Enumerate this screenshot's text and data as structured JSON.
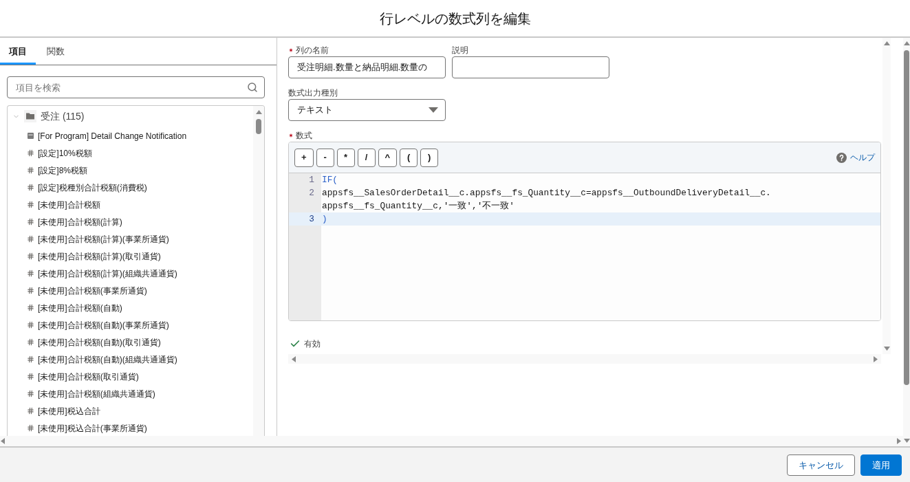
{
  "dialog": {
    "title": "行レベルの数式列を編集"
  },
  "sidebar": {
    "tabs": [
      {
        "label": "項目",
        "selected": true
      },
      {
        "label": "関数",
        "selected": false
      }
    ],
    "search": {
      "placeholder": "項目を検索"
    },
    "tree": [
      {
        "label": "受注 (115)",
        "expanded": true,
        "children": [
          {
            "kind": "date",
            "label": "[For Program] Detail Change Notification"
          },
          {
            "kind": "number",
            "label": "[設定]10%税額"
          },
          {
            "kind": "number",
            "label": "[設定]8%税額"
          },
          {
            "kind": "number",
            "label": "[設定]税種別合計税額(消費税)"
          },
          {
            "kind": "number",
            "label": "[未使用]合計税額"
          },
          {
            "kind": "number",
            "label": "[未使用]合計税額(計算)"
          },
          {
            "kind": "number",
            "label": "[未使用]合計税額(計算)(事業所通貨)"
          },
          {
            "kind": "number",
            "label": "[未使用]合計税額(計算)(取引通貨)"
          },
          {
            "kind": "number",
            "label": "[未使用]合計税額(計算)(組織共通通貨)"
          },
          {
            "kind": "number",
            "label": "[未使用]合計税額(事業所通貨)"
          },
          {
            "kind": "number",
            "label": "[未使用]合計税額(自動)"
          },
          {
            "kind": "number",
            "label": "[未使用]合計税額(自動)(事業所通貨)"
          },
          {
            "kind": "number",
            "label": "[未使用]合計税額(自動)(取引通貨)"
          },
          {
            "kind": "number",
            "label": "[未使用]合計税額(自動)(組織共通通貨)"
          },
          {
            "kind": "number",
            "label": "[未使用]合計税額(取引通貨)"
          },
          {
            "kind": "number",
            "label": "[未使用]合計税額(組織共通通貨)"
          },
          {
            "kind": "number",
            "label": "[未使用]税込合計"
          },
          {
            "kind": "number",
            "label": "[未使用]税込合計(事業所通貨)"
          }
        ]
      }
    ]
  },
  "form": {
    "column_name": {
      "label": "列の名前",
      "required": true,
      "value": "受注明細.数量と納品明細.数量の"
    },
    "description": {
      "label": "説明",
      "required": false
    },
    "output_type": {
      "label": "数式出力種別",
      "required": false,
      "value": "テキスト"
    },
    "formula": {
      "label": "数式",
      "required": true,
      "operators": [
        "+",
        "-",
        "*",
        "/",
        "^",
        "(",
        ")"
      ],
      "help": "ヘルプ",
      "lines": [
        {
          "number": "1",
          "active": false,
          "tokens": [
            {
              "kind": "keyword",
              "text": "IF("
            }
          ]
        },
        {
          "number": "2",
          "active": false,
          "tokens": [
            {
              "kind": "plain",
              "text": "appsfs__SalesOrderDetail__c.appsfs__fs_Quantity__c=appsfs__OutboundDeliveryDetail__c.appsfs__fs_Quantity__c,'一致','不一致'"
            }
          ]
        },
        {
          "number": "3",
          "active": true,
          "tokens": [
            {
              "kind": "keyword",
              "text": ")"
            }
          ]
        }
      ]
    },
    "validation": {
      "valid": true,
      "text": "有効"
    }
  },
  "footer": {
    "buttons": [
      {
        "kind": "secondary",
        "label": "キャンセル"
      },
      {
        "kind": "primary",
        "label": "適用"
      }
    ]
  }
}
